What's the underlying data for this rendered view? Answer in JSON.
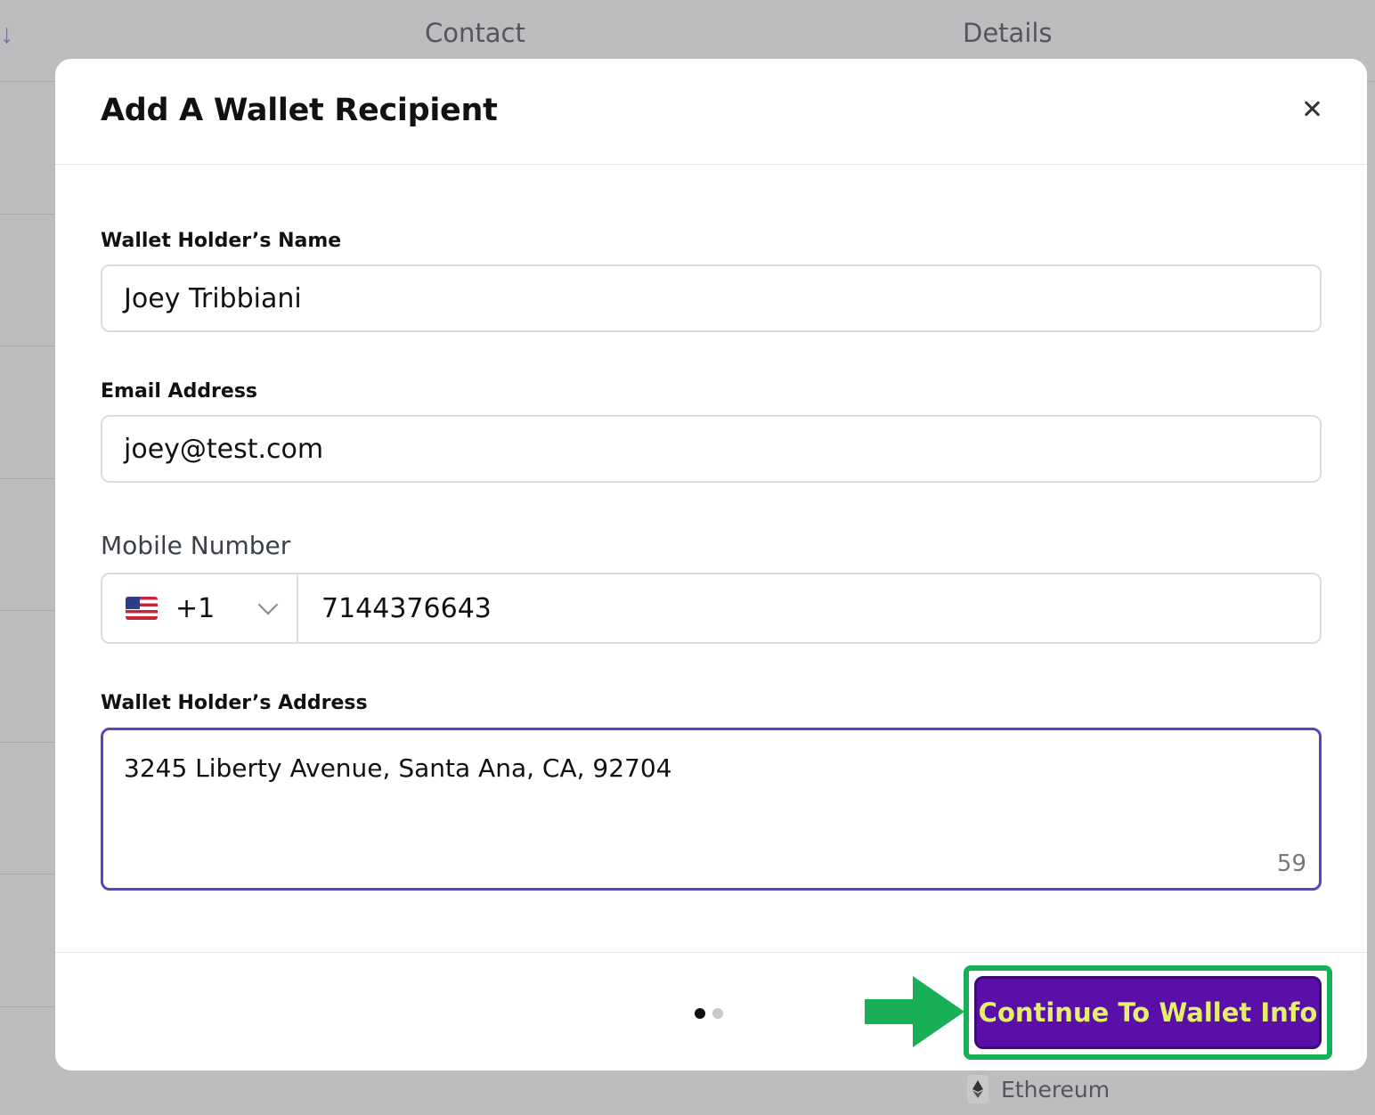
{
  "background": {
    "sort_icon": "↓",
    "columns": [
      "Contact",
      "Details"
    ],
    "network_label": "Ethereum",
    "network_icon": "ethereum-icon"
  },
  "modal": {
    "title": "Add A Wallet Recipient",
    "close_icon": "close-icon",
    "name": {
      "label": "Wallet Holder’s Name",
      "value": "Joey Tribbiani"
    },
    "email": {
      "label": "Email Address",
      "value": "joey@test.com"
    },
    "mobile": {
      "label": "Mobile Number",
      "country_code": "+1",
      "flag": "us-flag-icon",
      "value": "7144376643"
    },
    "address": {
      "label": "Wallet Holder’s Address",
      "value": "3245 Liberty Avenue, Santa Ana, CA, 92704",
      "char_count": "59"
    },
    "step": {
      "current": 1,
      "total": 2
    },
    "continue_label": "Continue To Wallet Info"
  },
  "colors": {
    "accent": "#5645c5",
    "cta_bg": "#5a10a8",
    "cta_text": "#e6ef6b",
    "highlight": "#18b057"
  }
}
